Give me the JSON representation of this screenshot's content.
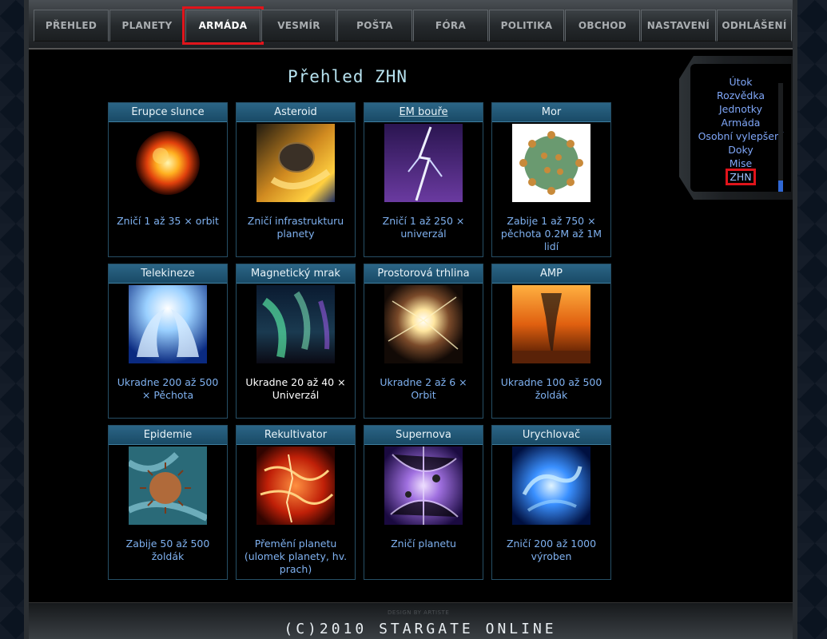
{
  "nav": {
    "items": [
      {
        "label": "PŘEHLED"
      },
      {
        "label": "PLANETY"
      },
      {
        "label": "ARMÁDA",
        "active": true
      },
      {
        "label": "VESMÍR"
      },
      {
        "label": "POŠTA"
      },
      {
        "label": "FÓRA"
      },
      {
        "label": "POLITIKA"
      },
      {
        "label": "OBCHOD"
      },
      {
        "label": "NASTAVENÍ"
      },
      {
        "label": "ODHLÁŠENÍ"
      }
    ]
  },
  "page": {
    "title": "Přehled ZHN"
  },
  "cards": [
    {
      "name": "Erupce slunce",
      "desc": "Zničí 1 až 35 × orbit",
      "icon": "solar-flare-icon"
    },
    {
      "name": "Asteroid",
      "desc": "Zničí infrastrukturu planety",
      "icon": "asteroid-icon"
    },
    {
      "name": "EM bouře",
      "desc": "Zničí 1 až 250 × univerzál",
      "icon": "em-storm-icon"
    },
    {
      "name": "Mor",
      "desc": "Zabije 1 až 750 × pěchota 0.2M až 1M lidí",
      "icon": "plague-icon"
    },
    {
      "name": "Telekineze",
      "desc": "Ukradne 200 až 500 × Pěchota",
      "icon": "telekinesis-icon"
    },
    {
      "name": "Magnetický mrak",
      "desc": "Ukradne 20 až 40 × Univerzál",
      "icon": "magnetic-cloud-icon"
    },
    {
      "name": "Prostorová trhlina",
      "desc": "Ukradne 2 až 6 × Orbit",
      "icon": "space-rift-icon"
    },
    {
      "name": "AMP",
      "desc": "Ukradne 100 až 500 žoldák",
      "icon": "amp-icon"
    },
    {
      "name": "Epidemie",
      "desc": "Zabije 50 až 500 žoldák",
      "icon": "epidemic-icon"
    },
    {
      "name": "Rekultivator",
      "desc": "Přemění planetu (ulomek planety, hv. prach)",
      "icon": "recultivator-icon"
    },
    {
      "name": "Supernova",
      "desc": "Zničí planetu",
      "icon": "supernova-icon"
    },
    {
      "name": "Urychlovač",
      "desc": "Zničí 200 až 1000 výroben",
      "icon": "accelerator-icon"
    }
  ],
  "sidemenu": {
    "items": [
      {
        "label": "Útok"
      },
      {
        "label": "Rozvědka"
      },
      {
        "label": "Jednotky"
      },
      {
        "label": "Armáda"
      },
      {
        "label": "Osobní vylepšení"
      },
      {
        "label": "Doky"
      },
      {
        "label": "Mise"
      },
      {
        "label": "ZHN",
        "active": true
      }
    ]
  },
  "footer": {
    "design": "DESIGN BY ARTISTE",
    "copyright": "(C)2010 STARGATE ONLINE"
  },
  "colors": {
    "accent_red": "#e0141b",
    "link_blue": "#7fb1f0",
    "card_header": "#1f5a7a"
  }
}
